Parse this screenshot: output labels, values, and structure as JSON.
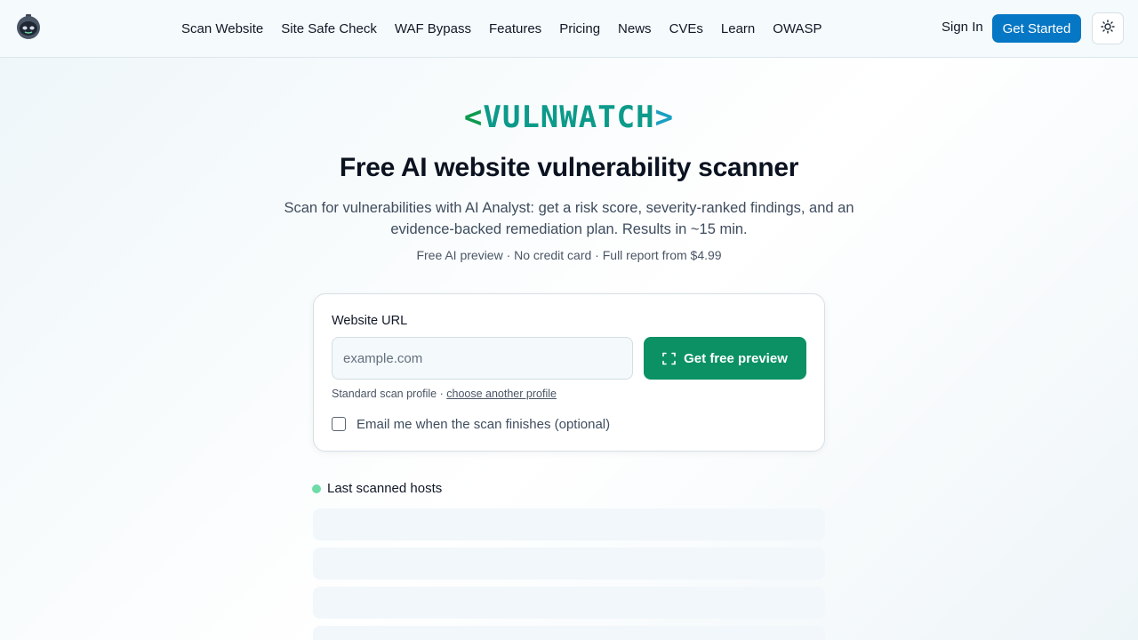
{
  "header": {
    "logo_icon": "robot-mascot-icon",
    "nav": [
      {
        "label": "Scan Website"
      },
      {
        "label": "Site Safe Check"
      },
      {
        "label": "WAF Bypass"
      },
      {
        "label": "Features"
      },
      {
        "label": "Pricing"
      },
      {
        "label": "News"
      },
      {
        "label": "CVEs"
      },
      {
        "label": "Learn"
      },
      {
        "label": "OWASP"
      }
    ],
    "sign_in": "Sign In",
    "get_started": "Get Started",
    "theme_icon": "sun-icon"
  },
  "hero": {
    "brand_open": "<",
    "brand_name": "VULNWATCH",
    "brand_close": ">",
    "title": "Free AI website vulnerability scanner",
    "subtitle": "Scan for vulnerabilities with AI Analyst: get a risk score, severity-ranked findings, and an evidence-backed remediation plan. Results in ~15 min.",
    "note": "Free AI preview · No credit card · Full report from $4.99"
  },
  "scan_form": {
    "label": "Website URL",
    "url_value": "",
    "url_placeholder": "example.com",
    "submit_label": "Get free preview",
    "submit_icon": "scan-frame-icon",
    "profile_prefix": "Standard scan profile · ",
    "profile_link": "choose another profile",
    "email_checked": false,
    "email_label": "Email me when the scan finishes (optional)"
  },
  "last_scanned": {
    "title": "Last scanned hosts",
    "status_color": "#6fdca8",
    "loading_rows": 4
  },
  "colors": {
    "accent_blue": "#0677c4",
    "accent_green": "#0b9163"
  }
}
